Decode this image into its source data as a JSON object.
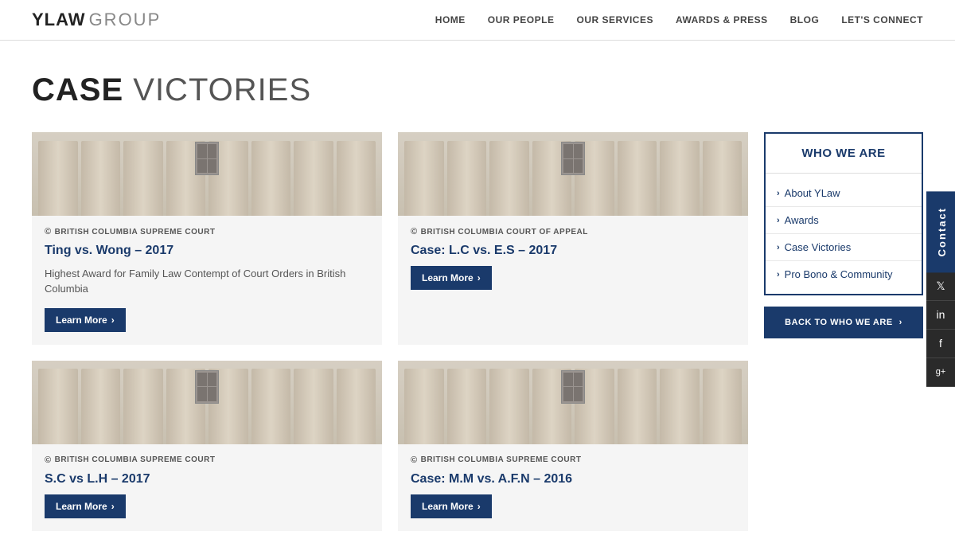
{
  "header": {
    "logo_bold": "YLAW",
    "logo_light": "GROUP",
    "nav": [
      {
        "label": "HOME",
        "id": "home"
      },
      {
        "label": "OUR PEOPLE",
        "id": "our-people"
      },
      {
        "label": "OUR SERVICES",
        "id": "our-services"
      },
      {
        "label": "AWARDS & PRESS",
        "id": "awards-press"
      },
      {
        "label": "BLOG",
        "id": "blog"
      },
      {
        "label": "LET'S CONNECT",
        "id": "lets-connect"
      }
    ]
  },
  "page": {
    "title_bold": "CASE",
    "title_light": "VICTORIES"
  },
  "sidebar": {
    "box_title": "WHO WE ARE",
    "links": [
      {
        "label": "About YLaw",
        "id": "about-ylaw"
      },
      {
        "label": "Awards",
        "id": "awards"
      },
      {
        "label": "Case Victories",
        "id": "case-victories"
      },
      {
        "label": "Pro Bono & Community",
        "id": "pro-bono"
      }
    ],
    "back_button": "BACK TO WHO WE ARE"
  },
  "cases": [
    {
      "court": "BRITISH COLUMBIA SUPREME COURT",
      "title": "Ting vs. Wong – 2017",
      "description": "Highest Award for Family Law Contempt of Court Orders in British Columbia",
      "learn_more": "Learn More",
      "has_description": true
    },
    {
      "court": "BRITISH COLUMBIA COURT OF APPEAL",
      "title": "Case: L.C vs. E.S – 2017",
      "description": "",
      "learn_more": "Learn More",
      "has_description": false
    },
    {
      "court": "BRITISH COLUMBIA SUPREME COURT",
      "title": "S.C vs L.H – 2017",
      "description": "",
      "learn_more": "Learn More",
      "has_description": false
    },
    {
      "court": "BRITISH COLUMBIA SUPREME COURT",
      "title": "Case: M.M vs. A.F.N – 2016",
      "description": "",
      "learn_more": "Learn More",
      "has_description": false
    }
  ],
  "contact": {
    "label": "Contact"
  },
  "social": {
    "icons": [
      {
        "name": "twitter",
        "symbol": "t"
      },
      {
        "name": "linkedin",
        "symbol": "in"
      },
      {
        "name": "facebook",
        "symbol": "f"
      },
      {
        "name": "google-plus",
        "symbol": "g+"
      },
      {
        "name": "twitter-alt",
        "symbol": "t"
      }
    ]
  }
}
